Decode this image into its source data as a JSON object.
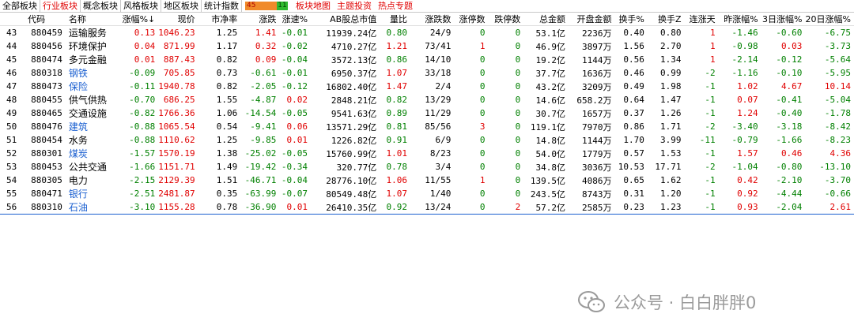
{
  "tabs": [
    {
      "label": "全部板块",
      "active": false
    },
    {
      "label": "行业板块",
      "active": true
    },
    {
      "label": "概念板块",
      "active": false
    },
    {
      "label": "风格板块",
      "active": false
    },
    {
      "label": "地区板块",
      "active": false
    },
    {
      "label": "统计指数",
      "active": false
    }
  ],
  "ratio": {
    "up": "45",
    "down": "11"
  },
  "extra_tabs": [
    "板块地图",
    "主题投资",
    "热点专题"
  ],
  "columns": [
    "",
    "代码",
    "名称",
    "涨幅%↓",
    "现价",
    "市净率",
    "涨跌",
    "涨速%",
    "AB股总市值",
    "量比",
    "涨跌数",
    "涨停数",
    "跌停数",
    "总金额",
    "开盘金额",
    "换手%",
    "换手Z",
    "连涨天",
    "昨涨幅%",
    "3日涨幅%",
    "20日涨幅%"
  ],
  "colors": {
    "red": "#e00000",
    "green": "#008000",
    "blue": "#1a5fd0"
  },
  "rows": [
    {
      "idx": "43",
      "code": "880459",
      "name": "运输服务",
      "nc": "k",
      "chg": "0.13",
      "price": "1046.23",
      "pb": "1.25",
      "diff": "1.41",
      "speed": "-0.01",
      "cap": "11939.24亿",
      "vr": "0.80",
      "ud": "24/9",
      "zt": "0",
      "dt": "0",
      "amt": "53.1亿",
      "open": "2236万",
      "turn": "0.40",
      "turnz": "0.80",
      "days": "1",
      "yday": "-1.46",
      "d3": "-0.60",
      "d20": "-6.75"
    },
    {
      "idx": "44",
      "code": "880456",
      "name": "环境保护",
      "nc": "k",
      "chg": "0.04",
      "price": "871.99",
      "pb": "1.17",
      "diff": "0.32",
      "speed": "-0.02",
      "cap": "4710.27亿",
      "vr": "1.21",
      "ud": "73/41",
      "zt": "1",
      "dt": "0",
      "amt": "46.9亿",
      "open": "3897万",
      "turn": "1.56",
      "turnz": "2.70",
      "days": "1",
      "yday": "-0.98",
      "d3": "0.03",
      "d20": "-3.73"
    },
    {
      "idx": "45",
      "code": "880474",
      "name": "多元金融",
      "nc": "k",
      "chg": "0.01",
      "price": "887.43",
      "pb": "0.82",
      "diff": "0.09",
      "speed": "-0.04",
      "cap": "3572.13亿",
      "vr": "0.86",
      "ud": "14/10",
      "zt": "0",
      "dt": "0",
      "amt": "19.2亿",
      "open": "1144万",
      "turn": "0.56",
      "turnz": "1.34",
      "days": "1",
      "yday": "-2.14",
      "d3": "-0.12",
      "d20": "-5.64"
    },
    {
      "idx": "46",
      "code": "880318",
      "name": "钢铁",
      "nc": "b",
      "chg": "-0.09",
      "price": "705.85",
      "pb": "0.73",
      "diff": "-0.61",
      "speed": "-0.01",
      "cap": "6950.37亿",
      "vr": "1.07",
      "ud": "33/18",
      "zt": "0",
      "dt": "0",
      "amt": "37.7亿",
      "open": "1636万",
      "turn": "0.46",
      "turnz": "0.99",
      "days": "-2",
      "yday": "-1.16",
      "d3": "-0.10",
      "d20": "-5.95"
    },
    {
      "idx": "47",
      "code": "880473",
      "name": "保险",
      "nc": "b",
      "chg": "-0.11",
      "price": "1940.78",
      "pb": "0.82",
      "diff": "-2.05",
      "speed": "-0.12",
      "cap": "16802.40亿",
      "vr": "1.47",
      "ud": "2/4",
      "zt": "0",
      "dt": "0",
      "amt": "43.2亿",
      "open": "3209万",
      "turn": "0.49",
      "turnz": "1.98",
      "days": "-1",
      "yday": "1.02",
      "d3": "4.67",
      "d20": "10.14"
    },
    {
      "idx": "48",
      "code": "880455",
      "name": "供气供热",
      "nc": "k",
      "chg": "-0.70",
      "price": "686.25",
      "pb": "1.55",
      "diff": "-4.87",
      "speed": "0.02",
      "cap": "2848.21亿",
      "vr": "0.82",
      "ud": "13/29",
      "zt": "0",
      "dt": "0",
      "amt": "14.6亿",
      "open": "658.2万",
      "turn": "0.64",
      "turnz": "1.47",
      "days": "-1",
      "yday": "0.07",
      "d3": "-0.41",
      "d20": "-5.04"
    },
    {
      "idx": "49",
      "code": "880465",
      "name": "交通设施",
      "nc": "k",
      "chg": "-0.82",
      "price": "1766.36",
      "pb": "1.06",
      "diff": "-14.54",
      "speed": "-0.05",
      "cap": "9541.63亿",
      "vr": "0.89",
      "ud": "11/29",
      "zt": "0",
      "dt": "0",
      "amt": "30.7亿",
      "open": "1657万",
      "turn": "0.37",
      "turnz": "1.26",
      "days": "-1",
      "yday": "1.24",
      "d3": "-0.40",
      "d20": "-1.78"
    },
    {
      "idx": "50",
      "code": "880476",
      "name": "建筑",
      "nc": "b",
      "chg": "-0.88",
      "price": "1065.54",
      "pb": "0.54",
      "diff": "-9.41",
      "speed": "0.06",
      "cap": "13571.29亿",
      "vr": "0.81",
      "ud": "85/56",
      "zt": "3",
      "dt": "0",
      "amt": "119.1亿",
      "open": "7970万",
      "turn": "0.86",
      "turnz": "1.71",
      "days": "-2",
      "yday": "-3.40",
      "d3": "-3.18",
      "d20": "-8.42"
    },
    {
      "idx": "51",
      "code": "880454",
      "name": "水务",
      "nc": "k",
      "chg": "-0.88",
      "price": "1110.62",
      "pb": "1.25",
      "diff": "-9.85",
      "speed": "0.01",
      "cap": "1226.82亿",
      "vr": "0.91",
      "ud": "6/9",
      "zt": "0",
      "dt": "0",
      "amt": "14.8亿",
      "open": "1144万",
      "turn": "1.70",
      "turnz": "3.99",
      "days": "-11",
      "yday": "-0.79",
      "d3": "-1.66",
      "d20": "-8.23"
    },
    {
      "idx": "52",
      "code": "880301",
      "name": "煤炭",
      "nc": "b",
      "chg": "-1.57",
      "price": "1570.19",
      "pb": "1.38",
      "diff": "-25.02",
      "speed": "-0.05",
      "cap": "15760.99亿",
      "vr": "1.01",
      "ud": "8/23",
      "zt": "0",
      "dt": "0",
      "amt": "54.0亿",
      "open": "1779万",
      "turn": "0.57",
      "turnz": "1.53",
      "days": "-1",
      "yday": "1.57",
      "d3": "0.46",
      "d20": "4.36"
    },
    {
      "idx": "53",
      "code": "880453",
      "name": "公共交通",
      "nc": "k",
      "chg": "-1.66",
      "price": "1151.71",
      "pb": "1.49",
      "diff": "-19.42",
      "speed": "-0.34",
      "cap": "320.77亿",
      "vr": "0.78",
      "ud": "3/4",
      "zt": "0",
      "dt": "0",
      "amt": "34.8亿",
      "open": "3036万",
      "turn": "10.53",
      "turnz": "17.71",
      "days": "-2",
      "yday": "-1.04",
      "d3": "-0.80",
      "d20": "-13.10"
    },
    {
      "idx": "54",
      "code": "880305",
      "name": "电力",
      "nc": "k",
      "chg": "-2.15",
      "price": "2129.39",
      "pb": "1.51",
      "diff": "-46.71",
      "speed": "-0.04",
      "cap": "28776.10亿",
      "vr": "1.06",
      "ud": "11/55",
      "zt": "1",
      "dt": "0",
      "amt": "139.5亿",
      "open": "4086万",
      "turn": "0.65",
      "turnz": "1.62",
      "days": "-1",
      "yday": "0.42",
      "d3": "-2.10",
      "d20": "-3.70"
    },
    {
      "idx": "55",
      "code": "880471",
      "name": "银行",
      "nc": "b",
      "chg": "-2.51",
      "price": "2481.87",
      "pb": "0.35",
      "diff": "-63.99",
      "speed": "-0.07",
      "cap": "80549.48亿",
      "vr": "1.07",
      "ud": "1/40",
      "zt": "0",
      "dt": "0",
      "amt": "243.5亿",
      "open": "8743万",
      "turn": "0.31",
      "turnz": "1.20",
      "days": "-1",
      "yday": "0.92",
      "d3": "-4.44",
      "d20": "-0.66"
    },
    {
      "idx": "56",
      "code": "880310",
      "name": "石油",
      "nc": "b",
      "chg": "-3.10",
      "price": "1155.28",
      "pb": "0.78",
      "diff": "-36.90",
      "speed": "0.01",
      "cap": "26410.35亿",
      "vr": "0.92",
      "ud": "13/24",
      "zt": "0",
      "dt": "2",
      "amt": "57.2亿",
      "open": "2585万",
      "turn": "0.23",
      "turnz": "1.23",
      "days": "-1",
      "yday": "0.93",
      "d3": "-2.04",
      "d20": "2.61"
    }
  ],
  "watermark": {
    "text": "公众号 · 白白胖胖0",
    "icon": "wechat-icon"
  }
}
